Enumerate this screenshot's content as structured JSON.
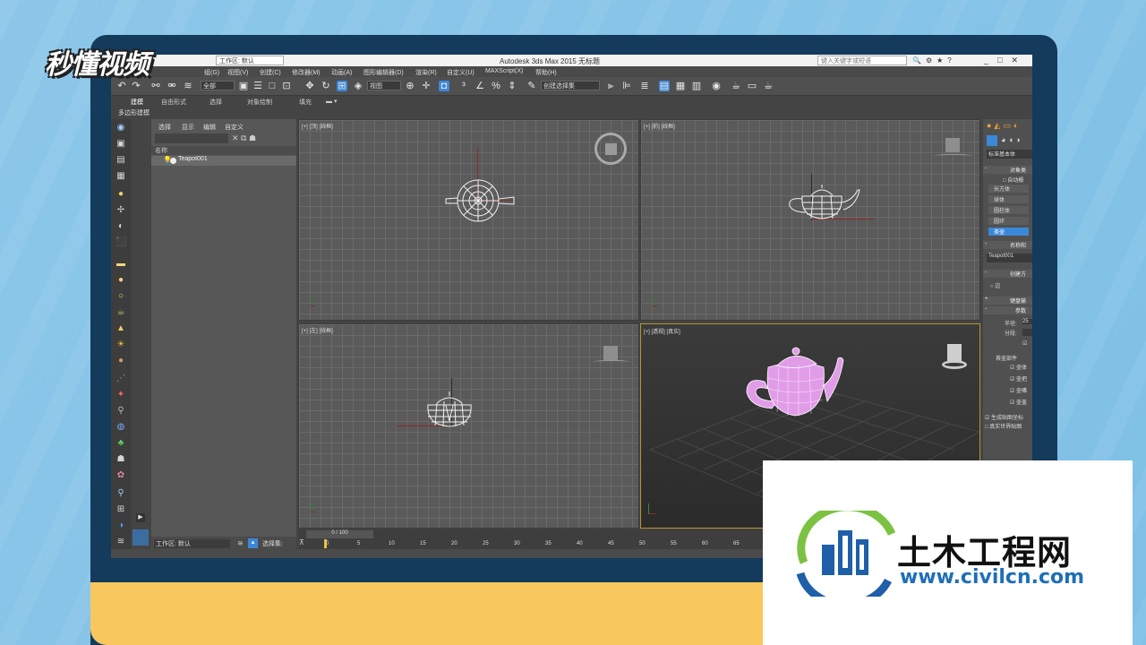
{
  "brand_top_left": "秒懂视频",
  "colors": {
    "background": "#8cc7e9",
    "monitor": "#143a5c",
    "stand": "#f8c75d",
    "selected_row": "#3b88d8",
    "teapot": "#e19ce8"
  },
  "app": {
    "title": "Autodesk 3ds Max  2015     无标题",
    "workspace": "工作区: 默认",
    "search_placeholder": "键入关键字或短语",
    "window_controls": [
      "_",
      "□",
      "✕"
    ],
    "menus": [
      "组(G)",
      "视图(V)",
      "创建(C)",
      "修改器(M)",
      "动画(A)",
      "图形编辑器(D)",
      "渲染(R)",
      "自定义(U)",
      "MAXScript(X)",
      "帮助(H)"
    ],
    "toolbar": {
      "filter_select": "全部",
      "view_select": "视图",
      "named_selection": "创建选择集"
    },
    "ribbon_tabs": [
      "建模",
      "自由形式",
      "选择",
      "对象绘制",
      "填充"
    ],
    "ribbon_sub": "多边形建模"
  },
  "explorer": {
    "tabs": [
      "选择",
      "显示",
      "编辑",
      "自定义"
    ],
    "column_header": "名称",
    "items": [
      {
        "name": "Teapot001"
      }
    ],
    "workspace": "工作区: 默认",
    "selection_set": "选择集:"
  },
  "viewports": [
    {
      "label": "[+] [顶] [线框]",
      "name": "top"
    },
    {
      "label": "[+] [前] [线框]",
      "name": "front"
    },
    {
      "label": "[+] [左] [线框]",
      "name": "left"
    },
    {
      "label": "[+] [透视] [真实]",
      "name": "perspective"
    }
  ],
  "command_panel": {
    "category": "标准基本体",
    "object_type_header": "对象类",
    "auto_grid": "自动栅",
    "primitives": [
      "长方体",
      "球体",
      "圆柱体",
      "圆环",
      "茶壶"
    ],
    "name_color_header": "名称和",
    "object_name": "Teapot001",
    "creation_method_header": "创建方",
    "creation_option": "边",
    "keyboard_entry_header": "键盘输",
    "params_header": "参数",
    "radius_label": "半径:",
    "radius_value": "25",
    "segments_label": "分段:",
    "parts_header": "茶壶部件",
    "parts": [
      "壶体",
      "壶把",
      "壶嘴",
      "壶盖"
    ],
    "gen_map": "生成贴图坐标",
    "real_world": "真实世界贴图"
  },
  "timeline": {
    "slider_text": "0 / 100",
    "ticks": [
      "0",
      "5",
      "10",
      "15",
      "20",
      "25",
      "30",
      "35",
      "40",
      "45",
      "50",
      "55",
      "60",
      "65"
    ]
  },
  "watermark": {
    "chinese": "土木工程网",
    "url": "www.civilcn.com"
  }
}
